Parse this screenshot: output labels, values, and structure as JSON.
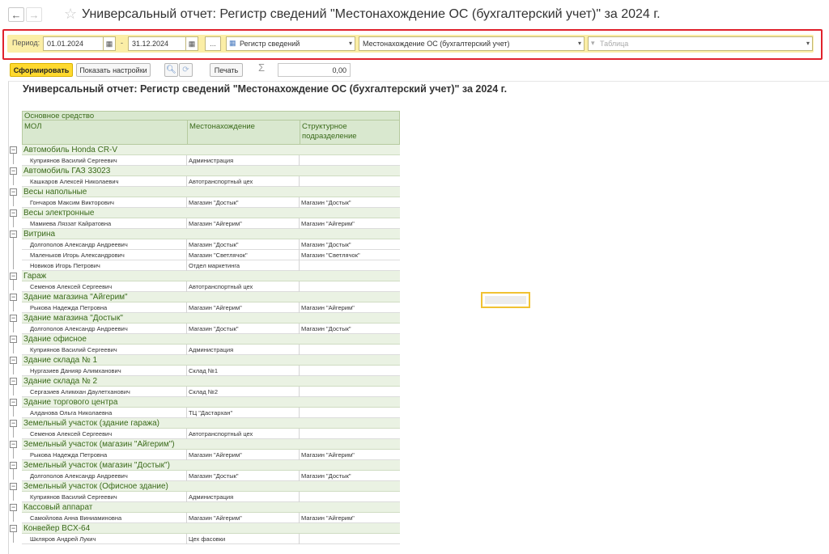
{
  "window": {
    "title": "Универсальный отчет: Регистр сведений \"Местонахождение ОС (бухгалтерский учет)\" за 2024 г."
  },
  "settings": {
    "period_label": "Период:",
    "date_from": "01.01.2024",
    "date_separator": "-",
    "date_to": "31.12.2024",
    "more_button": "...",
    "source_type": "Регистр сведений",
    "source_name": "Местонахождение ОС (бухгалтерский учет)",
    "table_placeholder": "Таблица"
  },
  "toolbar": {
    "generate": "Сформировать",
    "show_settings": "Показать настройки",
    "print": "Печать",
    "sigma": "Σ",
    "sum_value": "0,00"
  },
  "report": {
    "title": "Универсальный отчет: Регистр сведений \"Местонахождение ОС (бухгалтерский учет)\" за 2024 г.",
    "header_group": "Основное средство",
    "columns": [
      "МОЛ",
      "Местонахождение",
      "Структурное подразделение"
    ],
    "groups": [
      {
        "name": "Автомобиль Honda CR-V",
        "rows": [
          [
            "Куприянов Василий Сергеевич",
            "Администрация",
            ""
          ]
        ]
      },
      {
        "name": "Автомобиль ГАЗ 33023",
        "rows": [
          [
            "Кашкаров Алексей Николаевич",
            "Автотранспортный цех",
            ""
          ]
        ]
      },
      {
        "name": "Весы напольные",
        "rows": [
          [
            "Гончаров Максим Викторович",
            "Магазин \"Достык\"",
            "Магазин \"Достык\""
          ]
        ]
      },
      {
        "name": "Весы электронные",
        "rows": [
          [
            "Мамиева Ляззат Кайратовна",
            "Магазин \"Айгерим\"",
            "Магазин \"Айгерим\""
          ]
        ]
      },
      {
        "name": "Витрина",
        "rows": [
          [
            "Долгополов Александр Андреевич",
            "Магазин \"Достык\"",
            "Магазин \"Достык\""
          ],
          [
            "Маленьков Игорь Александрович",
            "Магазин \"Светлячок\"",
            "Магазин \"Светлячок\""
          ],
          [
            "Новиков Игорь Петрович",
            "Отдел маркетинга",
            ""
          ]
        ]
      },
      {
        "name": "Гараж",
        "rows": [
          [
            "Семенов Алексей Сергеевич",
            "Автотранспортный цех",
            ""
          ]
        ]
      },
      {
        "name": "Здание магазина \"Айгерим\"",
        "rows": [
          [
            "Рыкова Надежда Петровна",
            "Магазин \"Айгерим\"",
            "Магазин \"Айгерим\""
          ]
        ]
      },
      {
        "name": "Здание магазина \"Достык\"",
        "rows": [
          [
            "Долгополов Александр Андреевич",
            "Магазин \"Достык\"",
            "Магазин \"Достык\""
          ]
        ]
      },
      {
        "name": "Здание офисное",
        "rows": [
          [
            "Куприянов Василий Сергеевич",
            "Администрация",
            ""
          ]
        ]
      },
      {
        "name": "Здание склада № 1",
        "rows": [
          [
            "Нургазиев Данияр Алимханович",
            "Склад №1",
            ""
          ]
        ]
      },
      {
        "name": "Здание склада № 2",
        "rows": [
          [
            "Сергазиев Алимхан Даулетханович",
            "Склад №2",
            ""
          ]
        ]
      },
      {
        "name": "Здание торгового центра",
        "rows": [
          [
            "Алданова Ольга Николаевна",
            "ТЦ \"Дастархан\"",
            ""
          ]
        ]
      },
      {
        "name": "Земельный участок (здание гаража)",
        "rows": [
          [
            "Семенов Алексей Сергеевич",
            "Автотранспортный цех",
            ""
          ]
        ]
      },
      {
        "name": "Земельный участок (магазин \"Айгерим\")",
        "rows": [
          [
            "Рыкова Надежда Петровна",
            "Магазин \"Айгерим\"",
            "Магазин \"Айгерим\""
          ]
        ]
      },
      {
        "name": "Земельный участок (магазин \"Достык\")",
        "rows": [
          [
            "Долгополов Александр Андреевич",
            "Магазин \"Достык\"",
            "Магазин \"Достык\""
          ]
        ]
      },
      {
        "name": "Земельный участок (Офисное здание)",
        "rows": [
          [
            "Куприянов Василий Сергеевич",
            "Администрация",
            ""
          ]
        ]
      },
      {
        "name": "Кассовый аппарат",
        "rows": [
          [
            "Самойлова Анна Виниаминовна",
            "Магазин \"Айгерим\"",
            "Магазин \"Айгерим\""
          ]
        ]
      },
      {
        "name": "Конвейер BCX-64",
        "rows": [
          [
            "Шкляров Андрей Лукич",
            "Цех фасовки",
            ""
          ]
        ]
      }
    ]
  },
  "colors": {
    "accent_yellow": "#ffd92f",
    "settings_bg": "#fbeea6",
    "highlight_frame": "#e0222c",
    "group_green": "#3a6a1a"
  }
}
